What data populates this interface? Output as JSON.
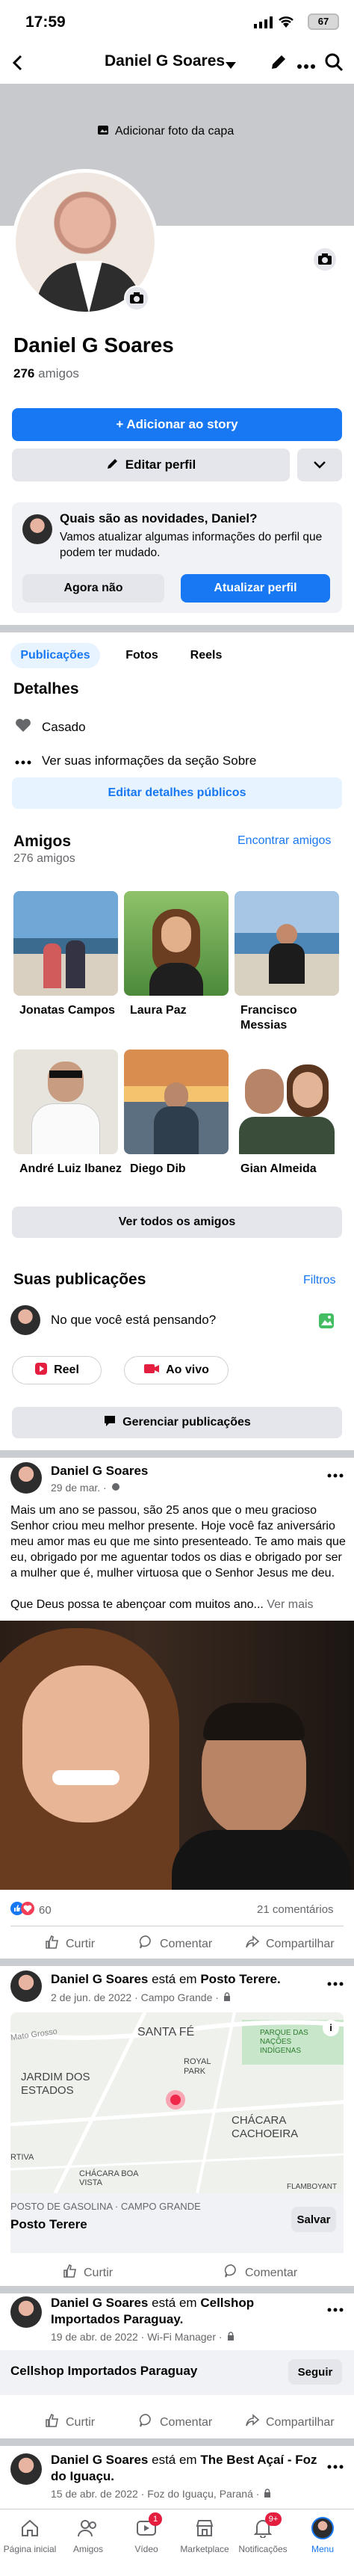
{
  "status": {
    "time": "17:59",
    "battery": "67"
  },
  "nav": {
    "title": "Daniel G Soares"
  },
  "cover": {
    "add_cover_label": "Adicionar foto da capa"
  },
  "profile": {
    "name": "Daniel G Soares",
    "friends_count": "276",
    "friends_label": "amigos",
    "add_story": "+ Adicionar ao story",
    "edit_profile": "Editar perfil"
  },
  "update_card": {
    "title": "Quais são as novidades, Daniel?",
    "text": "Vamos atualizar algumas informações do perfil que podem ter mudado.",
    "later": "Agora não",
    "update": "Atualizar perfil"
  },
  "tabs": [
    "Publicações",
    "Fotos",
    "Reels"
  ],
  "details": {
    "title": "Detalhes",
    "married": "Casado",
    "about": "Ver suas informações da seção Sobre",
    "edit": "Editar detalhes públicos"
  },
  "friends": {
    "title": "Amigos",
    "count": "276 amigos",
    "find": "Encontrar amigos",
    "list": [
      {
        "name": "Jonatas Campos"
      },
      {
        "name": "Laura Paz"
      },
      {
        "name": "Francisco Messias"
      },
      {
        "name": "André Luiz Ibanez"
      },
      {
        "name": "Diego Dib"
      },
      {
        "name": "Gian Almeida"
      }
    ],
    "see_all": "Ver todos os amigos"
  },
  "posts_section": {
    "title": "Suas publicações",
    "filters": "Filtros",
    "composer_placeholder": "No que você está pensando?",
    "reel": "Reel",
    "live": "Ao vivo",
    "manage": "Gerenciar publicações"
  },
  "post1": {
    "author": "Daniel G Soares",
    "date": "29 de mar. ·",
    "text": "Mais um ano se passou, são 25 anos que o meu gracioso Senhor criou meu melhor presente. Hoje você faz aniversário meu amor mas eu que me sinto presenteado. Te amo mais que eu, obrigado por me aguentar todos os dias e obrigado por ser a mulher que é, mulher virtuosa que o Senhor Jesus me deu.",
    "text2": "Que Deus possa te abençoar com muitos ano...",
    "more": "Ver mais",
    "reactions": "60",
    "comments": "21 comentários",
    "like": "Curtir",
    "comment": "Comentar",
    "share": "Compartilhar"
  },
  "post2": {
    "author": "Daniel G Soares",
    "verb": "está em",
    "place": "Posto Terere.",
    "date": "2 de jun. de 2022 · Campo Grande ·",
    "map_labels": [
      "Mato Grosso",
      "SANTA FÉ",
      "PARQUE DAS NAÇÕES INDÍGENAS",
      "ROYAL PARK",
      "JARDIM DOS ESTADOS",
      "CHÁCARA CACHOEIRA",
      "CHÁCARA BOA VISTA",
      "FLAMBOYANT",
      "RTIVA"
    ],
    "category": "POSTO DE GASOLINA · CAMPO GRANDE",
    "place_name": "Posto Terere",
    "save": "Salvar",
    "like": "Curtir",
    "comment": "Comentar"
  },
  "post3": {
    "author": "Daniel G Soares",
    "verb": "está em",
    "place": "Cellshop Importados Paraguay.",
    "date": "19 de abr. de 2022 · Wi-Fi Manager ·",
    "place_name": "Cellshop Importados Paraguay",
    "follow": "Seguir",
    "like": "Curtir",
    "comment": "Comentar",
    "share": "Compartilhar"
  },
  "post4": {
    "author": "Daniel G Soares",
    "verb": "está em",
    "place": "The Best Açaí - Foz do Iguaçu.",
    "date": "15 de abr. de 2022 · Foz do Iguaçu, Paraná ·"
  },
  "bottom_nav": [
    {
      "label": "Página inicial",
      "icon": "home-icon"
    },
    {
      "label": "Amigos",
      "icon": "friends-icon"
    },
    {
      "label": "Vídeo",
      "icon": "video-icon",
      "badge": "1"
    },
    {
      "label": "Marketplace",
      "icon": "marketplace-icon"
    },
    {
      "label": "Notificações",
      "icon": "bell-icon",
      "badge": "9+"
    },
    {
      "label": "Menu",
      "icon": "menu-icon"
    }
  ],
  "colors": {
    "accent": "#1877f2",
    "badge": "#e41e3f"
  }
}
